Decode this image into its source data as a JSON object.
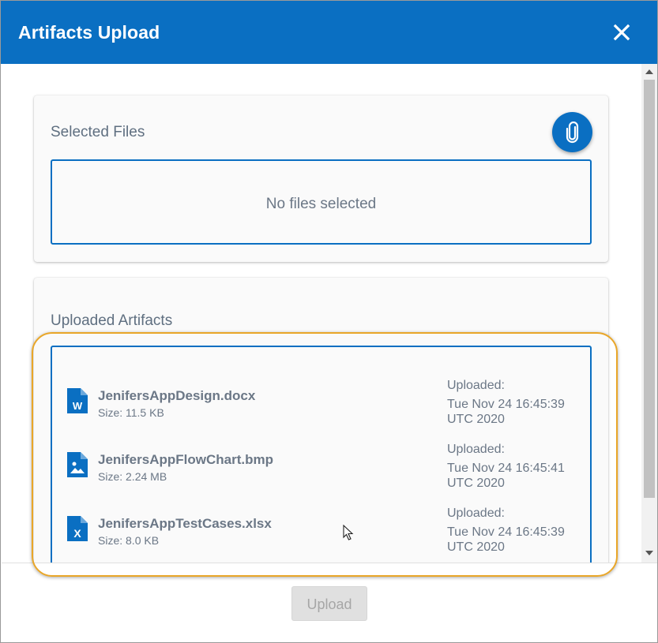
{
  "dialog": {
    "title": "Artifacts Upload",
    "close_icon": "close-icon"
  },
  "selected_files": {
    "title": "Selected Files",
    "attach_icon": "paperclip-icon",
    "empty_text": "No files selected"
  },
  "uploaded_artifacts": {
    "title": "Uploaded Artifacts",
    "items": [
      {
        "name": "JenifersAppDesign.docx",
        "size": "Size: 11.5 KB",
        "uploaded_label": "Uploaded:",
        "uploaded_date_line1": "Tue Nov 24 16:45:39",
        "uploaded_date_line2": "UTC 2020",
        "icon": "word-file-icon"
      },
      {
        "name": "JenifersAppFlowChart.bmp",
        "size": "Size: 2.24 MB",
        "uploaded_label": "Uploaded:",
        "uploaded_date_line1": "Tue Nov 24 16:45:41",
        "uploaded_date_line2": "UTC 2020",
        "icon": "image-file-icon"
      },
      {
        "name": "JenifersAppTestCases.xlsx",
        "size": "Size: 8.0 KB",
        "uploaded_label": "Uploaded:",
        "uploaded_date_line1": "Tue Nov 24 16:45:39",
        "uploaded_date_line2": "UTC 2020",
        "icon": "excel-file-icon"
      }
    ]
  },
  "footer": {
    "upload_label": "Upload"
  },
  "colors": {
    "brand": "#0a6fc2",
    "highlight": "#e9a628"
  }
}
